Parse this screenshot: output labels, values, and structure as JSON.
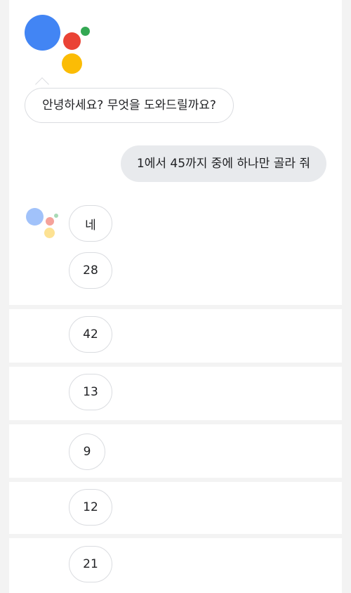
{
  "assistant": {
    "greeting": "안녕하세요? 무엇을 도와드릴까요?",
    "colors": {
      "blue": "#4285f4",
      "red": "#ea4335",
      "yellow": "#fbbc05",
      "green": "#34a853"
    }
  },
  "user_message": "1에서 45까지 중에 하나만 골라 줘",
  "replies": [
    "네",
    "28",
    "42",
    "13",
    "9",
    "12",
    "21"
  ]
}
